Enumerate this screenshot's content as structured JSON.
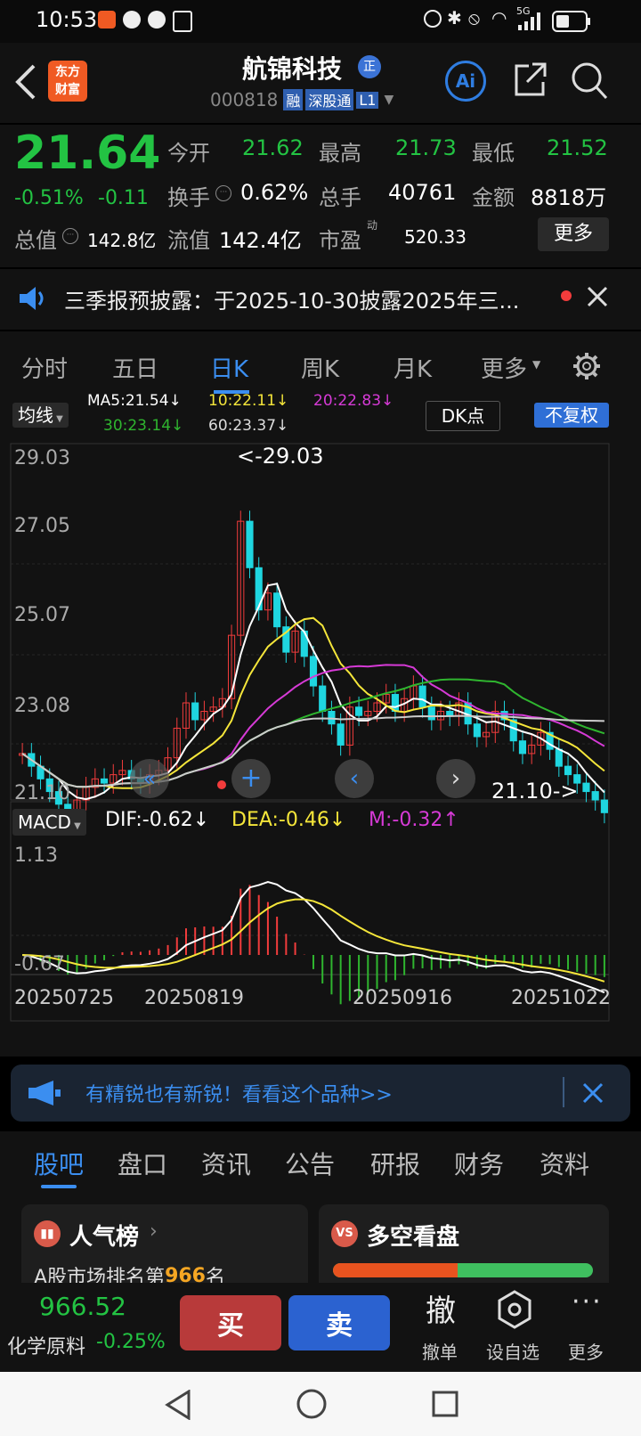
{
  "status": {
    "time": "10:53",
    "net": "5G"
  },
  "header": {
    "logo_line1": "东方",
    "logo_line2": "财富",
    "stock_name": "航锦科技",
    "badge_zheng": "正",
    "code": "000818",
    "tag_rong": "融",
    "tag_sgt": "深股通",
    "tag_l1": "L1",
    "ai_label": "Ai"
  },
  "quote": {
    "price": "21.64",
    "change_pct": "-0.51%",
    "change": "-0.11",
    "open_label": "今开",
    "open": "21.62",
    "high_label": "最高",
    "high": "21.73",
    "low_label": "最低",
    "low": "21.52",
    "turnover_label": "换手",
    "turnover": "0.62%",
    "volume_label": "总手",
    "volume": "40761",
    "amount_label": "金额",
    "amount": "8818万",
    "mktcap_label": "总值",
    "mktcap": "142.8亿",
    "float_label": "流值",
    "float": "142.4亿",
    "pe_label": "市盈",
    "pe_sup": "动",
    "pe": "520.33",
    "more": "更多"
  },
  "notice": {
    "text": "三季报预披露：于2025-10-30披露2025年三..."
  },
  "ktabs": [
    "分时",
    "五日",
    "日K",
    "周K",
    "月K",
    "更多"
  ],
  "ktab_active": "日K",
  "chart": {
    "ma_select": "均线",
    "ma5": "MA5:21.54↓",
    "ma10": "10:22.11↓",
    "ma20": "20:22.83↓",
    "ma30": "30:23.14↓",
    "ma60": "60:23.37↓",
    "dk": "DK点",
    "fq": "不复权",
    "y_labels": [
      "29.03",
      "27.05",
      "25.07",
      "23.08",
      "21.10"
    ],
    "high_mark": "<-29.03",
    "low_mark": "21.10->",
    "macd_select": "MACD",
    "dif": "DIF:-0.62↓",
    "dea": "DEA:-0.46↓",
    "m": "M:-0.32↑",
    "macd_top": "1.13",
    "macd_bottom": "-0.67",
    "x_labels": [
      "20250725",
      "20250819",
      "20250916",
      "20251022"
    ],
    "colors": {
      "up": "#f23c3c",
      "down": "#1fd6e0",
      "ma5": "#ffffff",
      "ma10": "#f5e63a",
      "ma20": "#d63ad6",
      "ma30": "#2fb52f",
      "ma60": "#cccccc"
    }
  },
  "chart_data": {
    "type": "candlestick",
    "ylim": [
      21.1,
      29.03
    ],
    "close_series_approx": [
      23.0,
      22.7,
      22.4,
      22.1,
      21.8,
      21.6,
      21.9,
      22.2,
      22.4,
      22.3,
      22.5,
      22.6,
      22.4,
      22.3,
      22.5,
      22.6,
      22.9,
      23.6,
      24.2,
      23.8,
      24.0,
      24.1,
      24.3,
      25.8,
      28.5,
      27.4,
      26.4,
      26.8,
      26.0,
      25.4,
      25.9,
      25.3,
      24.6,
      24.0,
      23.7,
      23.2,
      24.1,
      23.9,
      24.0,
      24.2,
      24.4,
      24.0,
      24.3,
      24.6,
      24.1,
      23.8,
      24.0,
      23.9,
      24.2,
      23.7,
      23.4,
      23.5,
      24.0,
      23.8,
      23.3,
      23.0,
      23.2,
      23.5,
      23.1,
      22.7,
      22.5,
      22.3,
      22.1,
      21.9,
      21.6
    ]
  },
  "promo": {
    "text": "有精锐也有新锐！看看这个品种>>"
  },
  "subtabs": [
    "股吧",
    "盘口",
    "资讯",
    "公告",
    "研报",
    "财务",
    "资料"
  ],
  "subtab_active": "股吧",
  "cards": {
    "popularity_title": "人气榜",
    "rank_prefix": "A股市场排名第",
    "rank": "966",
    "rank_suffix": "名",
    "duokong_title": "多空看盘",
    "bull_ratio": 0.48
  },
  "bottom": {
    "sector_value": "966.52",
    "sector_name": "化学原料",
    "sector_change": "-0.25%",
    "buy": "买",
    "sell": "卖",
    "cancel_big": "撤",
    "cancel": "撤单",
    "watch": "设自选",
    "more": "更多"
  }
}
